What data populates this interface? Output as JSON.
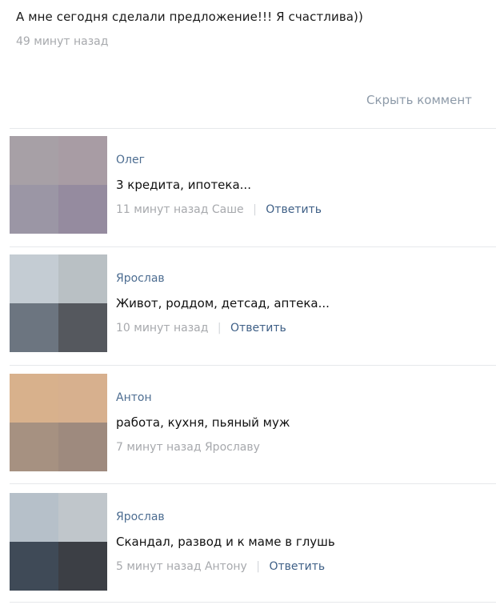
{
  "post": {
    "text": "А мне сегодня сделали предложение!!! Я счастлива))",
    "time": "49 минут назад",
    "hide_comments": "Скрыть коммент"
  },
  "comments": [
    {
      "author": "Олег",
      "text": "3 кредита, ипотека...",
      "time": "11 минут назад",
      "to": "Саше",
      "reply": "Ответить",
      "avatar_colors": [
        "#a7a0a6",
        "#a89ca4",
        "#9b96a5",
        "#958b9f"
      ]
    },
    {
      "author": "Ярослав",
      "text": "Живот, роддом, детсад, аптека...",
      "time": "10 минут назад",
      "to": "",
      "reply": "Ответить",
      "avatar_colors": [
        "#c4ccd3",
        "#b9c0c4",
        "#6c7580",
        "#55585e"
      ]
    },
    {
      "author": "Антон",
      "text": "работа, кухня, пьяный муж",
      "time": "7 минут назад",
      "to": "Ярославу",
      "reply": "",
      "avatar_colors": [
        "#d8b18c",
        "#d7b08e",
        "#a69181",
        "#9e8a7e"
      ]
    },
    {
      "author": "Ярослав",
      "text": "Скандал, развод и к маме в глушь",
      "time": "5 минут назад",
      "to": "Антону",
      "reply": "Ответить",
      "avatar_colors": [
        "#b6c0c9",
        "#c0c6cb",
        "#3f4a57",
        "#3c3f45"
      ]
    }
  ]
}
